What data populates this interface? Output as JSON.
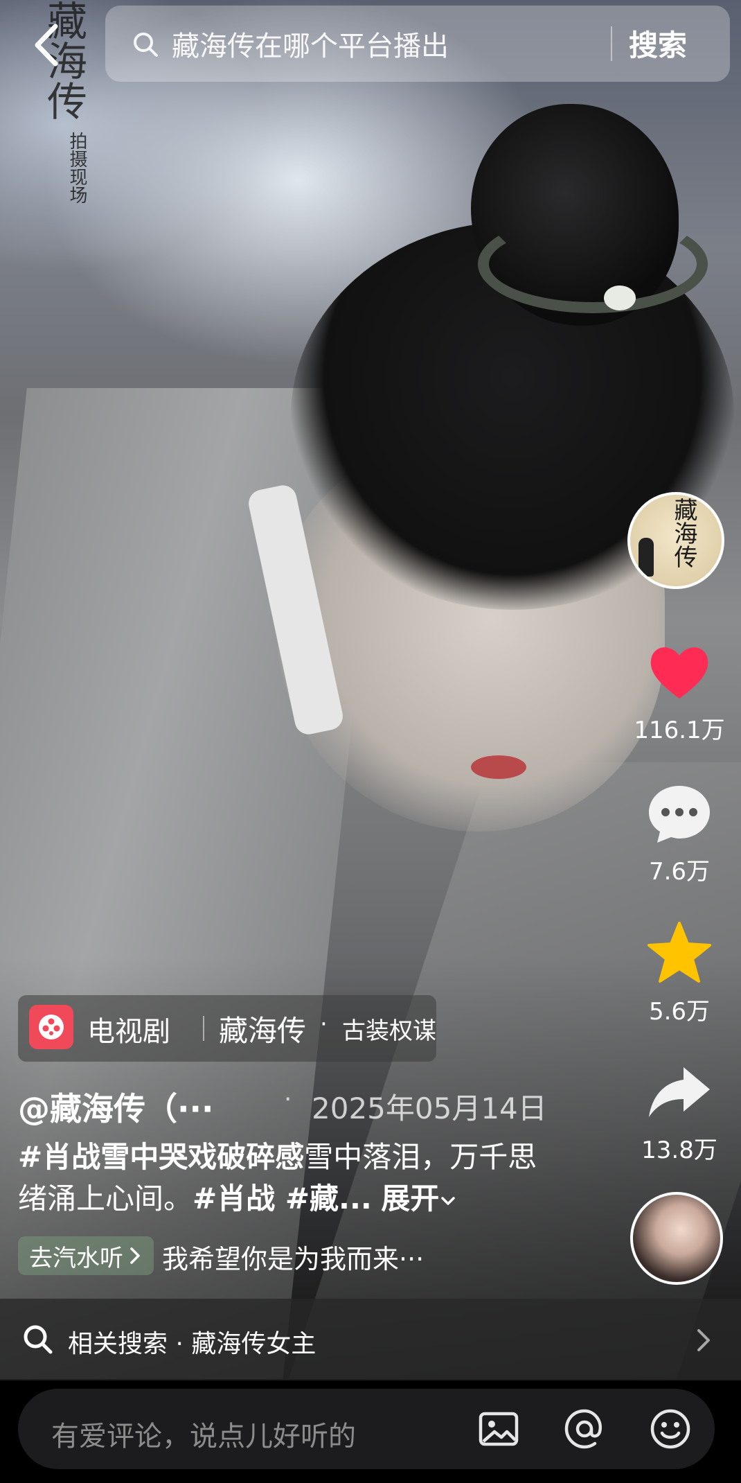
{
  "header": {
    "search_text": "藏海传在哪个平台播出",
    "search_button": "搜索",
    "icons": {
      "back": "chevron-left-icon",
      "search": "search-icon"
    }
  },
  "poster": {
    "title_vertical": "藏海传",
    "subtitle_vertical": "拍摄现场"
  },
  "actions": {
    "creator_avatar_text": "藏海传",
    "like_count": "116.1万",
    "comment_count": "7.6万",
    "favorite_count": "5.6万",
    "share_count": "13.8万",
    "icons": {
      "like": "heart-icon",
      "comment": "comment-bubble-icon",
      "favorite": "star-icon",
      "share": "share-arrow-icon",
      "music_avatar": "music-disc-avatar"
    },
    "colors": {
      "like": "#FE2C55",
      "favorite": "#FFC300"
    }
  },
  "tag_card": {
    "type": "电视剧",
    "name": "藏海传",
    "separator": "·",
    "genre": "古装权谋",
    "icon": "tv-series-icon",
    "icon_color": "#F04A5A"
  },
  "post": {
    "author": "@藏海传（···",
    "dot": "·",
    "date": "2025年05月14日",
    "caption_hashtag": "#肖战雪中哭戏破碎感",
    "caption_text": "雪中落泪，万千思绪涌上心间。",
    "caption_tags": "#肖战 #藏...",
    "expand": "展开"
  },
  "music": {
    "chip_label": "去汽水听",
    "song_text": "我希望你是为我而来···"
  },
  "related": {
    "label": "相关搜索 · 藏海传女主",
    "icons": {
      "search": "search-icon",
      "chevron": "chevron-right-icon"
    }
  },
  "comment_bar": {
    "placeholder": "有爱评论，说点儿好听的",
    "icons": {
      "image": "image-icon",
      "mention": "at-mention-icon",
      "emoji": "emoji-icon"
    }
  }
}
